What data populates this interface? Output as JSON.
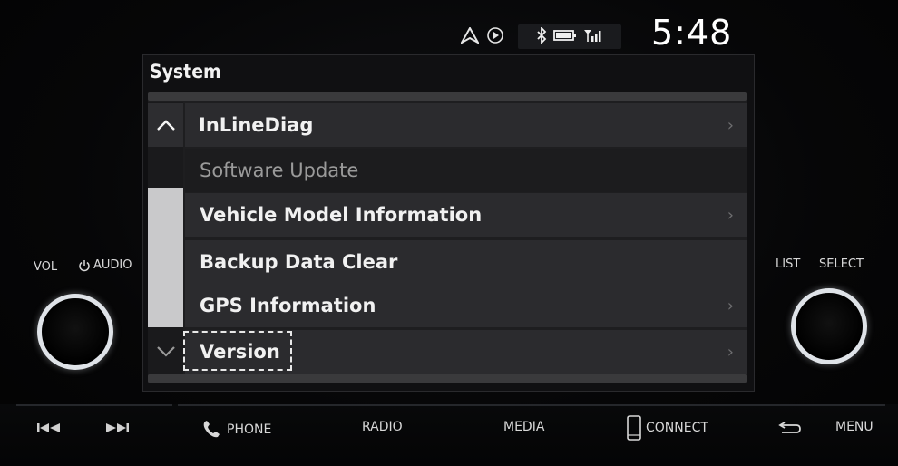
{
  "status": {
    "icons": [
      "navigation-icon",
      "play-icon",
      "bluetooth-icon",
      "battery-icon",
      "signal-icon"
    ],
    "time": "5:48"
  },
  "screen": {
    "title": "System",
    "items": [
      {
        "label": "InLineDiag",
        "enabled": true
      },
      {
        "label": "Software Update",
        "enabled": false
      },
      {
        "label": "Vehicle Model Information",
        "enabled": true
      },
      {
        "label": "Backup Data Clear",
        "enabled": true
      },
      {
        "label": "GPS Information",
        "enabled": true
      },
      {
        "label": "Version",
        "enabled": true,
        "focused": true
      }
    ]
  },
  "knobs": {
    "left_vol": "VOL",
    "left_audio": "AUDIO",
    "right_list": "LIST",
    "right_select": "SELECT"
  },
  "hardware_buttons": {
    "phone": "PHONE",
    "radio": "RADIO",
    "media": "MEDIA",
    "connect": "CONNECT",
    "menu": "MENU"
  }
}
